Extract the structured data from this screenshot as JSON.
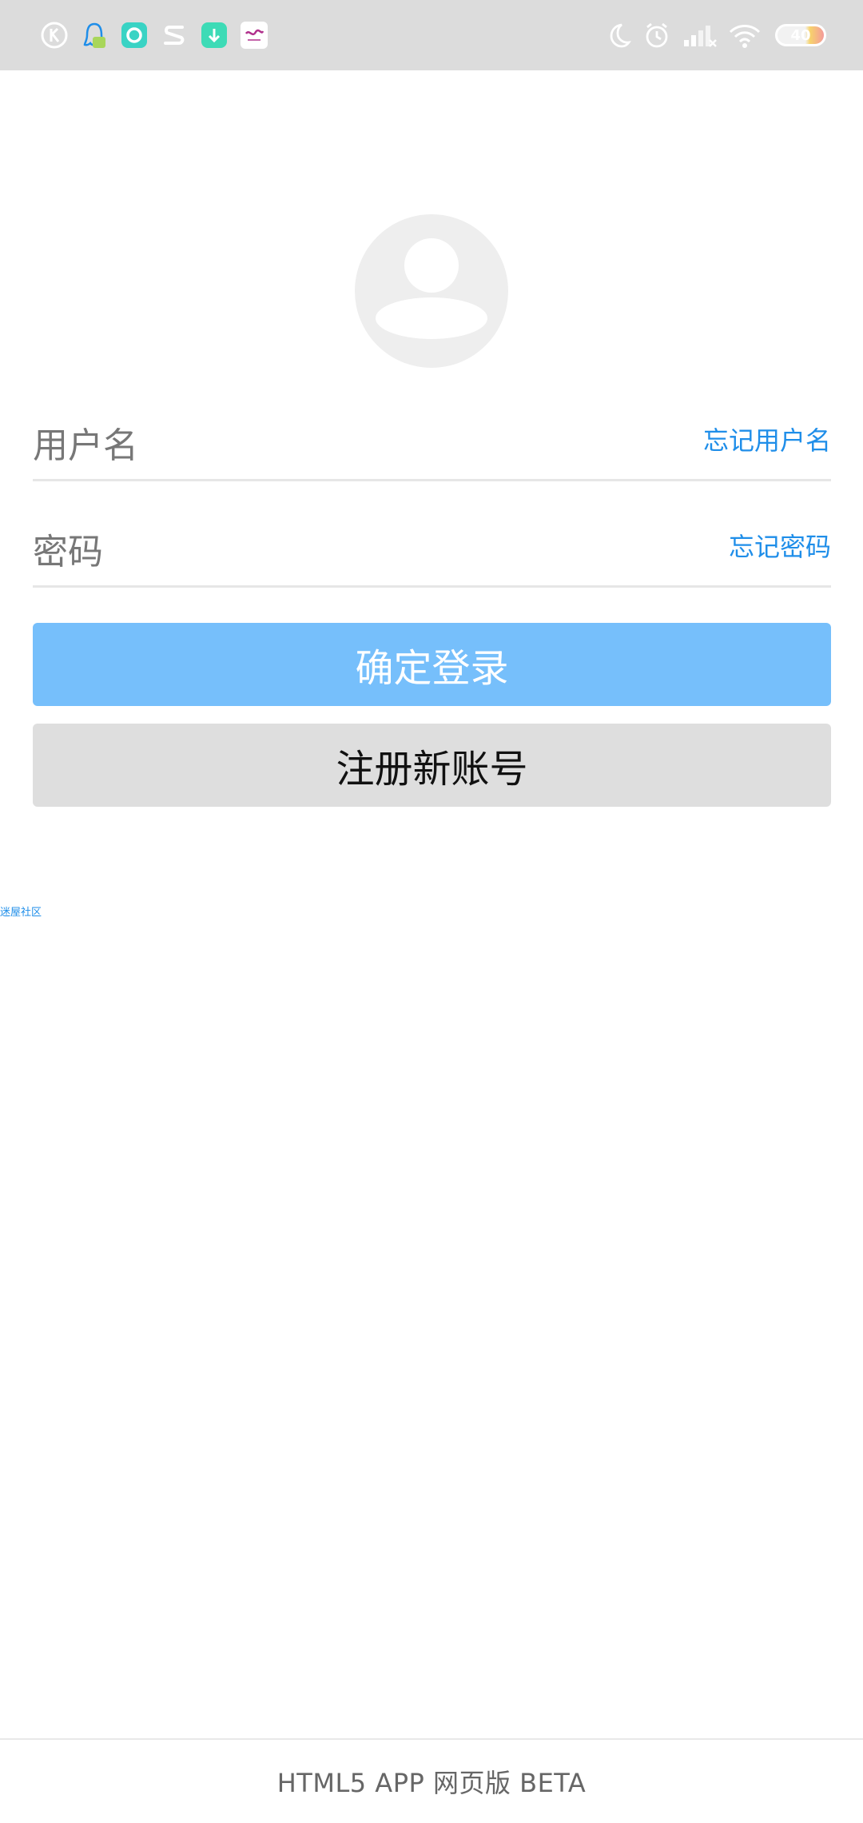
{
  "status_bar": {
    "left_icons": [
      "k-app-icon",
      "qq-icon",
      "circle-app-icon",
      "s-app-icon",
      "download-app-icon",
      "flower-app-icon"
    ],
    "right_icons": [
      "moon-icon",
      "alarm-icon",
      "signal-icon",
      "wifi-icon"
    ],
    "battery_level": "40",
    "background": "#dcdcdc"
  },
  "form": {
    "username_placeholder": "用户名",
    "forgot_username": "忘记用户名",
    "password_placeholder": "密码",
    "forgot_password": "忘记密码"
  },
  "buttons": {
    "login_label": "确定登录",
    "register_label": "注册新账号"
  },
  "misc": {
    "tiny_link": "迷屋社区"
  },
  "footer": {
    "text": "HTML5 APP 网页版 BETA"
  },
  "colors": {
    "accent": "#1f8ee9",
    "login_button": "#76bffb",
    "register_button": "#dedede"
  }
}
